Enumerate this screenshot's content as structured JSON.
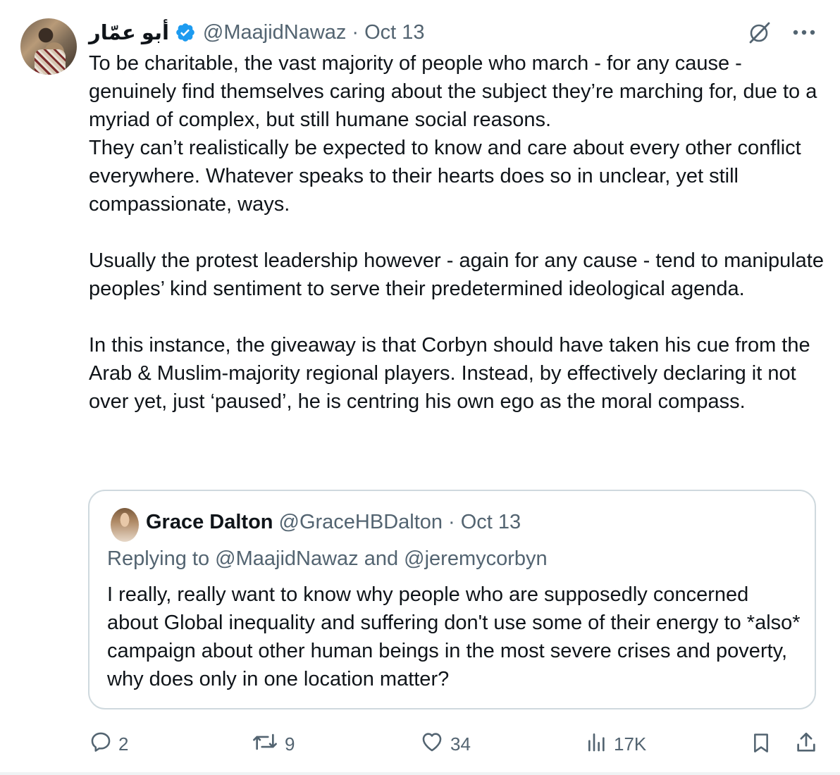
{
  "tweet": {
    "display_name": "أبو عمّار",
    "handle": "@MaajidNawaz",
    "separator": "·",
    "date": "Oct 13",
    "body": "To be charitable, the vast majority of people who march - for any cause - genuinely find themselves caring about the subject they’re marching for, due to a myriad of complex, but still humane social reasons.\nThey can’t realistically be expected to know and care about every other conflict everywhere. Whatever speaks to their hearts does so in unclear, yet still compassionate, ways.\n\nUsually the protest leadership however - again for any cause - tend to manipulate peoples’ kind sentiment to serve their predetermined ideological agenda.\n\nIn this instance, the giveaway is that Corbyn should have taken his cue from the Arab & Muslim-majority regional players. Instead, by effectively declaring it not over yet, just ‘paused’, he is centring his own ego as the moral compass."
  },
  "quote": {
    "display_name": "Grace Dalton",
    "handle": "@GraceHBDalton",
    "separator": "·",
    "date": "Oct 13",
    "replying_to": "Replying to @MaajidNawaz and @jeremycorbyn",
    "body": "I really, really want to know why people who are supposedly concerned about Global inequality and suffering don't use some of their energy to *also* campaign about other human beings in the most severe crises and poverty, why does only in one location matter?"
  },
  "actions": {
    "replies": "2",
    "reposts": "9",
    "likes": "34",
    "views": "17K"
  },
  "icons": {
    "verified": "verified-badge-icon",
    "grok": "grok-icon",
    "more": "more-icon",
    "reply": "reply-icon",
    "repost": "repost-icon",
    "like": "like-icon",
    "views": "views-icon",
    "bookmark": "bookmark-icon",
    "share": "share-icon"
  },
  "colors": {
    "text": "#0f1419",
    "secondary": "#536471",
    "verified": "#1d9bf0",
    "border": "#cfd9de"
  }
}
